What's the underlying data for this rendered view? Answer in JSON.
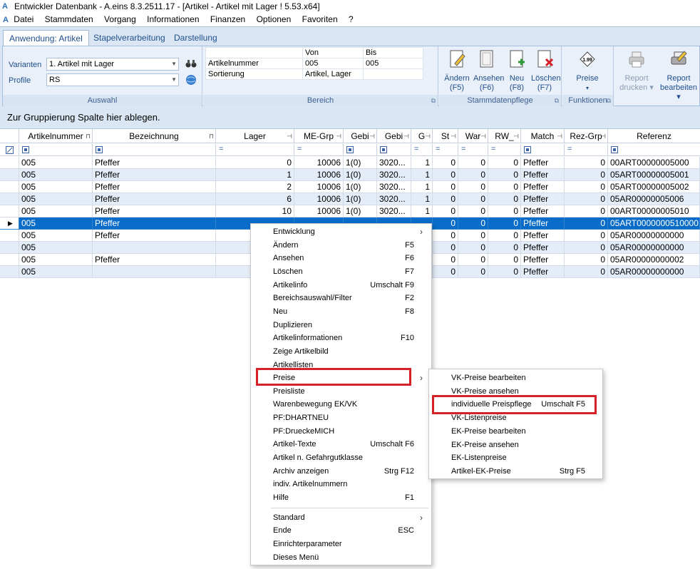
{
  "titlebar": {
    "logo": "A",
    "title": "Entwickler Datenbank - A.eins 8.3.2511.17 - [Artikel - Artikel mit Lager ! 5.53.x64]"
  },
  "menubar": [
    "Datei",
    "Stammdaten",
    "Vorgang",
    "Informationen",
    "Finanzen",
    "Optionen",
    "Favoriten",
    "?"
  ],
  "ribbon": {
    "tabs": [
      "Anwendung: Artikel",
      "Stapelverarbeitung",
      "Darstellung"
    ],
    "auswahl": {
      "varianten_label": "Varianten",
      "varianten_value": "1. Artikel mit Lager",
      "profile_label": "Profile",
      "profile_value": "RS",
      "title": "Auswahl"
    },
    "bereich": {
      "col_von": "Von",
      "col_bis": "Bis",
      "rows": [
        [
          "Artikelnummer",
          "005",
          "005"
        ],
        [
          "Sortierung",
          "Artikel, Lager",
          ""
        ]
      ],
      "title": "Bereich"
    },
    "stammdaten": {
      "buttons": [
        {
          "label": "Ändern",
          "key": "(F5)"
        },
        {
          "label": "Ansehen",
          "key": "(F6)"
        },
        {
          "label": "Neu",
          "key": "(F8)"
        },
        {
          "label": "Löschen",
          "key": "(F7)"
        }
      ],
      "title": "Stammdatenpflege"
    },
    "funktionen": {
      "preise_label": "Preise",
      "preise_icon_text": "1.99",
      "title": "Funktionen"
    },
    "report": {
      "drucken": [
        "Report",
        "drucken"
      ],
      "bearbeiten": [
        "Report",
        "bearbeiten"
      ]
    }
  },
  "grouping_hint": "Zur Gruppierung Spalte hier ablegen.",
  "grid": {
    "headers": [
      "Artikelnummer",
      "Bezeichnung",
      "Lager",
      "ME-Grp",
      "Gebi",
      "Gebi",
      "G",
      "St",
      "War",
      "RW_",
      "Match",
      "Rez-Grp",
      "Referenz"
    ],
    "rows": [
      [
        "005",
        "Pfeffer",
        "0",
        "10006",
        "1(0)",
        "3020...",
        "1",
        "0",
        "0",
        "0",
        "Pfeffer",
        "0",
        "00ART00000005000"
      ],
      [
        "005",
        "Pfeffer",
        "1",
        "10006",
        "1(0)",
        "3020...",
        "1",
        "0",
        "0",
        "0",
        "Pfeffer",
        "0",
        "05ART00000005001"
      ],
      [
        "005",
        "Pfeffer",
        "2",
        "10006",
        "1(0)",
        "3020...",
        "1",
        "0",
        "0",
        "0",
        "Pfeffer",
        "0",
        "05ART00000005002"
      ],
      [
        "005",
        "Pfeffer",
        "6",
        "10006",
        "1(0)",
        "3020...",
        "1",
        "0",
        "0",
        "0",
        "Pfeffer",
        "0",
        "05AR00000005006"
      ],
      [
        "005",
        "Pfeffer",
        "10",
        "10006",
        "1(0)",
        "3020...",
        "1",
        "0",
        "0",
        "0",
        "Pfeffer",
        "0",
        "00ART00000005010"
      ],
      [
        "005",
        "Pfeffer",
        "",
        "",
        "",
        "",
        "",
        "0",
        "0",
        "0",
        "Pfeffer",
        "0",
        "05ART0000000510000"
      ],
      [
        "005",
        "Pfeffer",
        "",
        "",
        "",
        "",
        "",
        "0",
        "0",
        "0",
        "Pfeffer",
        "0",
        "05AR00000000000"
      ],
      [
        "005",
        "",
        "",
        "",
        "",
        "",
        "",
        "0",
        "0",
        "0",
        "Pfeffer",
        "0",
        "05AR00000000000"
      ],
      [
        "005",
        "Pfeffer",
        "",
        "",
        "",
        "",
        "",
        "0",
        "0",
        "0",
        "Pfeffer",
        "0",
        "05AR00000000002"
      ],
      [
        "005",
        "",
        "",
        "",
        "",
        "",
        "",
        "0",
        "0",
        "0",
        "Pfeffer",
        "0",
        "05AR00000000000"
      ]
    ]
  },
  "context_menu": [
    {
      "label": "Entwicklung",
      "key": "",
      "sub": true
    },
    {
      "label": "Ändern",
      "key": "F5"
    },
    {
      "label": "Ansehen",
      "key": "F6"
    },
    {
      "label": "Löschen",
      "key": "F7"
    },
    {
      "label": "Artikelinfo",
      "key": "Umschalt F9"
    },
    {
      "label": "Bereichsauswahl/Filter",
      "key": "F2"
    },
    {
      "label": "Neu",
      "key": "F8"
    },
    {
      "label": "Duplizieren",
      "key": ""
    },
    {
      "label": "Artikelinformationen",
      "key": "F10"
    },
    {
      "label": "Zeige Artikelbild",
      "key": ""
    },
    {
      "label": "Artikellisten",
      "key": ""
    },
    {
      "label": "Preise",
      "key": "",
      "sub": true
    },
    {
      "label": "Preisliste",
      "key": ""
    },
    {
      "label": "Warenbewegung EK/VK",
      "key": ""
    },
    {
      "label": "PF:DHARTNEU",
      "key": ""
    },
    {
      "label": "PF:DrueckeMICH",
      "key": ""
    },
    {
      "label": "Artikel-Texte",
      "key": "Umschalt F6"
    },
    {
      "label": "Artikel n. Gefahrgutklasse",
      "key": ""
    },
    {
      "label": "Archiv anzeigen",
      "key": "Strg F12"
    },
    {
      "label": "indiv. Artikelnummern",
      "key": ""
    },
    {
      "label": "Hilfe",
      "key": "F1"
    },
    {
      "label": "Standard",
      "key": "",
      "sub": true
    },
    {
      "label": "Ende",
      "key": "ESC"
    },
    {
      "label": "Einrichterparameter",
      "key": ""
    },
    {
      "label": "Dieses Menü",
      "key": ""
    }
  ],
  "submenu": [
    {
      "label": "VK-Preise bearbeiten",
      "key": ""
    },
    {
      "label": "VK-Preise ansehen",
      "key": ""
    },
    {
      "label": "individuelle Preispflege",
      "key": "Umschalt F5"
    },
    {
      "label": "VK-Listenpreise",
      "key": ""
    },
    {
      "label": "EK-Preise bearbeiten",
      "key": ""
    },
    {
      "label": "EK-Preise ansehen",
      "key": ""
    },
    {
      "label": "EK-Listenpreise",
      "key": ""
    },
    {
      "label": "Artikel-EK-Preise",
      "key": "Strg F5"
    }
  ],
  "colors": {
    "selection": "#0a6cc9",
    "highlight_box": "#d42027",
    "ribbon": "#dae6f3"
  }
}
